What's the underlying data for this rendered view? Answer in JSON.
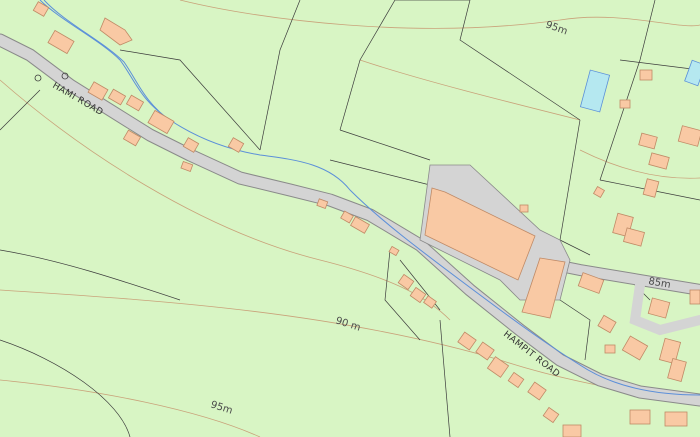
{
  "map": {
    "colors": {
      "land": "#d8f5c4",
      "road": "#d4d4d4",
      "road_edge": "#8a8a8a",
      "building": "#f9c9a4",
      "building_edge": "#c08a66",
      "water": "#b5e8f0",
      "stream": "#5b8fd9",
      "boundary": "#3c3c3c",
      "contour": "#c9a27a"
    },
    "road_labels": [
      {
        "name": "HAMPIT ROAD",
        "shown": "HAMI ROAD"
      },
      {
        "name": "HAMPIT ROAD",
        "shown": "HAMPIT ROAD"
      }
    ],
    "contour_labels": [
      "95m",
      "90 m",
      "95m",
      "85m"
    ],
    "features": {
      "buildings": "residential and industrial",
      "watercourse": "stream"
    }
  }
}
